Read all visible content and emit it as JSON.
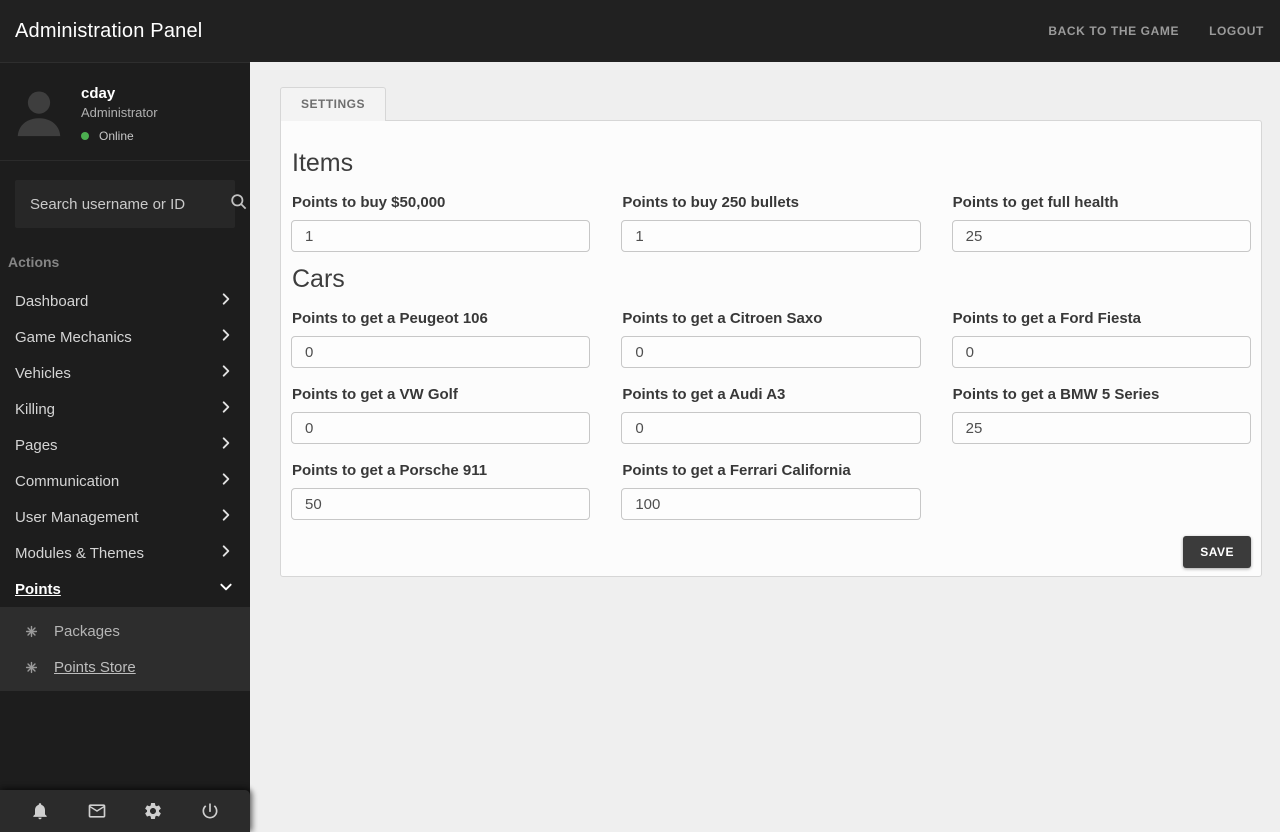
{
  "topbar": {
    "title": "Administration Panel",
    "links": [
      {
        "label": "BACK TO THE GAME"
      },
      {
        "label": "LOGOUT"
      }
    ]
  },
  "sidebar": {
    "user": {
      "name": "cday",
      "role": "Administrator",
      "status": "Online",
      "status_color": "#4caf50"
    },
    "search": {
      "placeholder": "Search username or ID"
    },
    "actions_label": "Actions",
    "menu": [
      {
        "label": "Dashboard"
      },
      {
        "label": "Game Mechanics"
      },
      {
        "label": "Vehicles"
      },
      {
        "label": "Killing"
      },
      {
        "label": "Pages"
      },
      {
        "label": "Communication"
      },
      {
        "label": "User Management"
      },
      {
        "label": "Modules & Themes"
      },
      {
        "label": "Points",
        "expanded": true,
        "active": true
      }
    ],
    "submenu": [
      {
        "label": "Packages"
      },
      {
        "label": "Points Store",
        "active": true
      }
    ],
    "footer_icons": [
      "bell-icon",
      "mail-icon",
      "gear-icon",
      "power-icon"
    ]
  },
  "main": {
    "tab": "SETTINGS",
    "sections": [
      {
        "title": "Items",
        "fields": [
          {
            "label": "Points to buy $50,000",
            "value": "1"
          },
          {
            "label": "Points to buy 250 bullets",
            "value": "1"
          },
          {
            "label": "Points to get full health",
            "value": "25"
          }
        ]
      },
      {
        "title": "Cars",
        "fields": [
          {
            "label": "Points to get a Peugeot 106",
            "value": "0"
          },
          {
            "label": "Points to get a Citroen Saxo",
            "value": "0"
          },
          {
            "label": "Points to get a Ford Fiesta",
            "value": "0"
          },
          {
            "label": "Points to get a VW Golf",
            "value": "0"
          },
          {
            "label": "Points to get a Audi A3",
            "value": "0"
          },
          {
            "label": "Points to get a BMW 5 Series",
            "value": "25"
          },
          {
            "label": "Points to get a Porsche 911",
            "value": "50"
          },
          {
            "label": "Points to get a Ferrari California",
            "value": "100"
          }
        ]
      }
    ],
    "save_label": "SAVE"
  },
  "colors": {
    "topbar_bg": "#212121",
    "sidebar_bg": "#1d1d1d",
    "submenu_bg": "#2d2d2d",
    "accent_online": "#4caf50",
    "main_bg": "#efefef",
    "card_bg": "#fcfcfc",
    "save_bg": "#3b3b3b"
  }
}
